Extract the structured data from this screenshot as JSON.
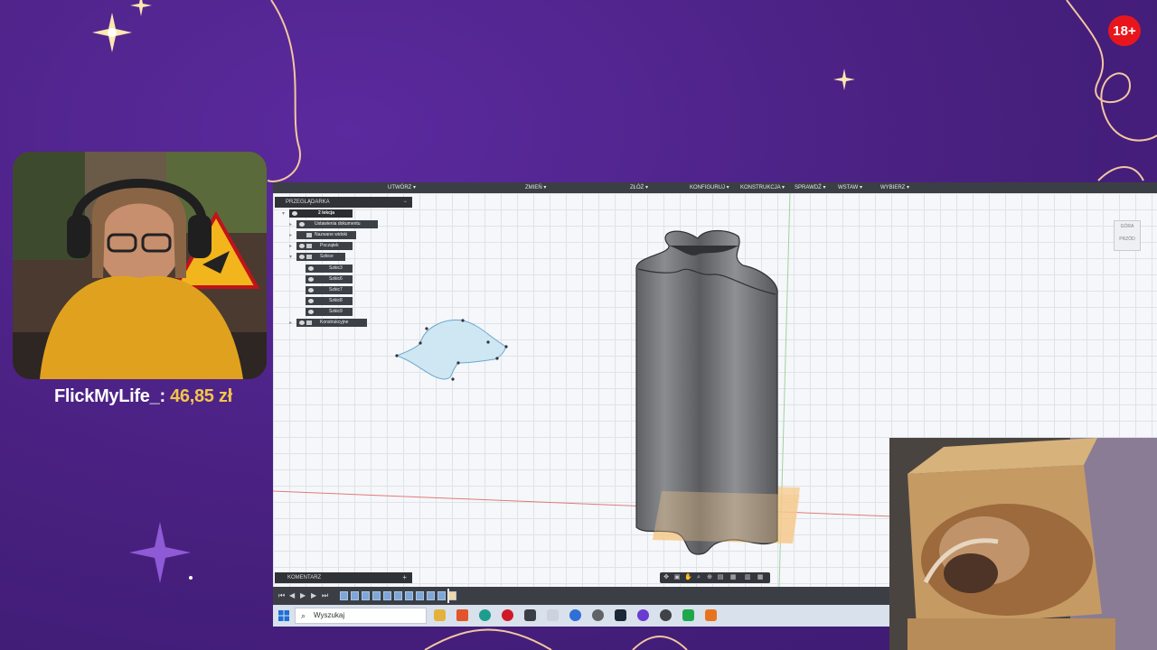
{
  "badge": {
    "age_rating": "18+"
  },
  "donation": {
    "name": "FlickMyLife_:",
    "amount": "46,85 zł"
  },
  "cad": {
    "menu": [
      "UTWÓRZ ▾",
      "ZMIEŃ ▾",
      "ZŁÓŻ ▾",
      "KONFIGURUJ ▾",
      "KONSTRUKCJA ▾",
      "SPRAWDŹ ▾",
      "WSTAW ▾",
      "WYBIERZ ▾"
    ],
    "browser": {
      "title": "PRZEGLĄDARKA",
      "collapse": "−",
      "root": "2 lekcja",
      "items": [
        "Ustawienia dokumentu",
        "Nazwane widoki",
        "Początek",
        "Szkice",
        "Szkic3",
        "Szkic6",
        "Szkic7",
        "Szkic8",
        "Szkic9",
        "Konstrukcyjne"
      ]
    },
    "viewcube": {
      "top": "GÓRA",
      "front": "PRZÓD"
    },
    "comments": {
      "title": "KOMENTARZ",
      "add": "+"
    }
  },
  "taskbar": {
    "search_placeholder": "Wyszukaj"
  },
  "colors": {
    "purple_bg": "#4a1f86",
    "accent_gold": "#f3c64a",
    "badge_red": "#e8161c",
    "sketch_fill": "#cfe6f3",
    "body_grey": "#6f7276"
  },
  "icons": [
    "windows-start-icon",
    "search-icon",
    "file-explorer-icon",
    "brave-icon",
    "edge-icon",
    "opera-icon",
    "steam-icon",
    "fusion360-icon"
  ]
}
